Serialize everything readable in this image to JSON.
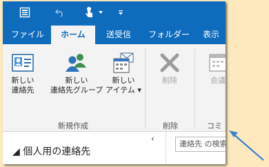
{
  "tabs": [
    {
      "label": "ファイル",
      "active": false
    },
    {
      "label": "ホーム",
      "active": true
    },
    {
      "label": "送受信",
      "active": false
    },
    {
      "label": "フォルダー",
      "active": false
    },
    {
      "label": "表示",
      "active": false
    }
  ],
  "ribbon": {
    "new_contact": "新しい\n連絡先",
    "new_contact_group": "新しい\n連絡先グループ",
    "new_items": "新しい\nアイテム ▾",
    "delete": "削除",
    "meeting": "会議",
    "group_new": "新規作成",
    "group_delete": "削除",
    "group_communicate": "コミ"
  },
  "lower": {
    "collapse": "‹",
    "section_title": "◢ 個人用の連絡先",
    "search_placeholder": "連絡先 の検索"
  },
  "colors": {
    "accent": "#0f6cbd",
    "ribbon_bg": "#f3f3f3",
    "page_bg": "#fde9bd",
    "arrow": "#3c82d2"
  }
}
